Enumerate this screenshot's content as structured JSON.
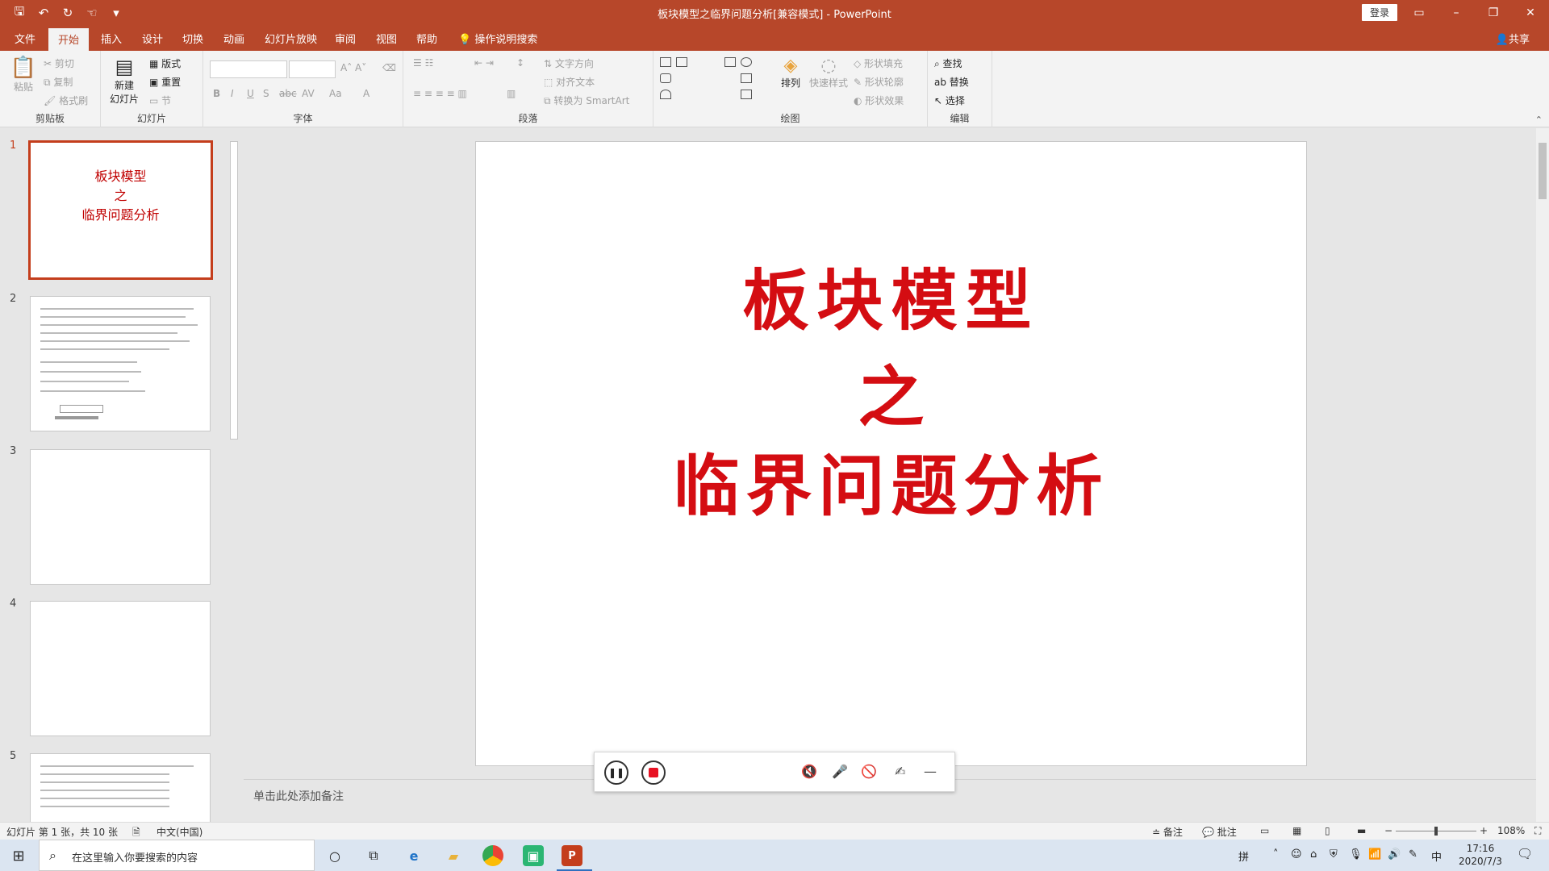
{
  "window": {
    "title": "板块模型之临界问题分析[兼容模式]  -  PowerPoint",
    "login": "登录",
    "minimize": "–",
    "restore": "❐",
    "close": "✕"
  },
  "qat": {
    "save": "🖫",
    "undo": "↶",
    "redo": "↻",
    "touch": "☜",
    "more": "▾"
  },
  "tabs": [
    "文件",
    "开始",
    "插入",
    "设计",
    "切换",
    "动画",
    "幻灯片放映",
    "审阅",
    "视图",
    "帮助"
  ],
  "tellme": "操作说明搜索",
  "share": "共享",
  "ribbon": {
    "clipboard": {
      "label": "剪贴板",
      "paste": "粘贴",
      "cut": "剪切",
      "copy": "复制",
      "format": "格式刷"
    },
    "slides": {
      "label": "幻灯片",
      "new": "新建",
      "new2": "幻灯片",
      "layout": "版式",
      "reset": "重置",
      "section": "节"
    },
    "font": {
      "label": "字体",
      "bold": "B",
      "italic": "I",
      "underline": "U",
      "shadow": "S",
      "strike": "abc",
      "spacing": "AV",
      "case": "Aa",
      "color": "A"
    },
    "paragraph": {
      "label": "段落",
      "textdir": "文字方向",
      "align": "对齐文本",
      "smartart": "转换为 SmartArt"
    },
    "drawing": {
      "label": "绘图",
      "arrange": "排列",
      "quick": "快速样式",
      "fill": "形状填充",
      "outline": "形状轮廓",
      "effect": "形状效果"
    },
    "editing": {
      "label": "编辑",
      "find": "查找",
      "replace": "替换",
      "select": "选择"
    }
  },
  "thumbs": {
    "n1": "1",
    "n2": "2",
    "n3": "3",
    "n4": "4",
    "n5": "5",
    "s1_l1": "板块模型",
    "s1_l2": "之",
    "s1_l3": "临界问题分析"
  },
  "slide": {
    "line1": "板块模型",
    "line2": "之",
    "line3": "临界问题分析"
  },
  "notes": "单击此处添加备注",
  "status": {
    "slide_info": "幻灯片 第 1 张，共 10 张",
    "lang": "中文(中国)",
    "notes": "备注",
    "comments": "批注",
    "zoom": "108%"
  },
  "taskbar": {
    "search_placeholder": "在这里输入你要搜索的内容",
    "ime1": "拼",
    "ime2": "中",
    "time": "17:16",
    "date": "2020/7/3"
  }
}
